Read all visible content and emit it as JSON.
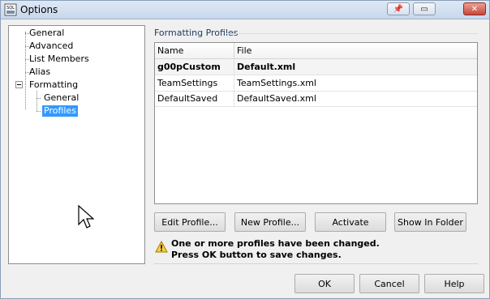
{
  "window": {
    "title": "Options",
    "app_icon_text": "SQL",
    "pin_label": "📌",
    "restore_label": "▭",
    "close_label": "✕"
  },
  "tree": {
    "items": [
      {
        "label": "General"
      },
      {
        "label": "Advanced"
      },
      {
        "label": "List Members"
      },
      {
        "label": "Alias"
      },
      {
        "label": "Formatting"
      },
      {
        "label": "General"
      },
      {
        "label": "Profiles"
      }
    ],
    "selected": "Profiles"
  },
  "profiles": {
    "group_label": "Formatting Profiles",
    "columns": [
      "Name",
      "File"
    ],
    "rows": [
      {
        "name": "g00pCustom",
        "file": "Default.xml",
        "active": true
      },
      {
        "name": "TeamSettings",
        "file": "TeamSettings.xml",
        "active": false
      },
      {
        "name": "DefaultSaved",
        "file": "DefaultSaved.xml",
        "active": false
      }
    ]
  },
  "actions": {
    "edit": "Edit Profile...",
    "new": "New Profile...",
    "activate": "Activate",
    "show_in_folder": "Show In Folder"
  },
  "warning": {
    "line1": "One or more profiles have been changed.",
    "line2": "Press OK button to save changes."
  },
  "dialog_buttons": {
    "ok": "OK",
    "cancel": "Cancel",
    "help": "Help"
  }
}
